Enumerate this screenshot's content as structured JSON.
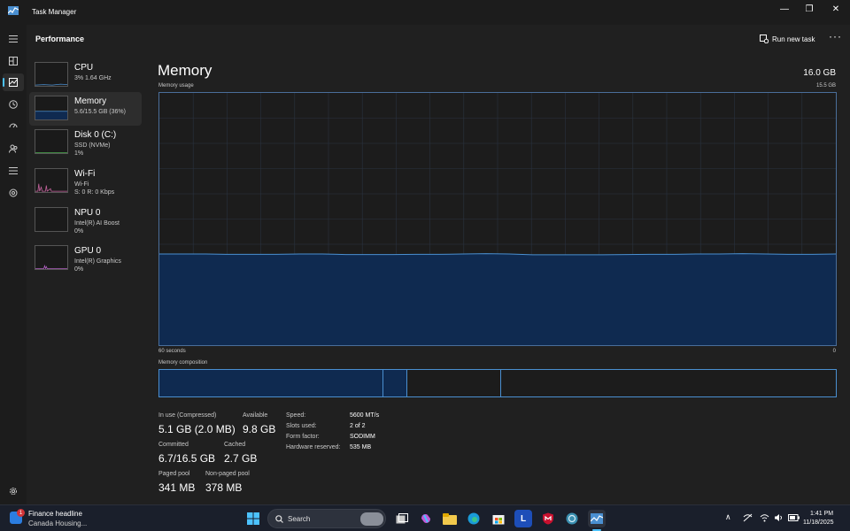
{
  "window": {
    "title": "Task Manager",
    "minimize": "—",
    "restore": "❐",
    "close": "✕"
  },
  "header": {
    "page_title": "Performance",
    "run_new_task": "Run new task",
    "more": "···"
  },
  "sidebar": {
    "items": [
      {
        "name": "CPU",
        "sub1": "3% 1.64 GHz",
        "sub2": "",
        "sub3": "",
        "color": "#4a8fd0"
      },
      {
        "name": "Memory",
        "sub1": "5.6/15.5 GB (36%)",
        "sub2": "",
        "sub3": "",
        "color": "#4a8fd0"
      },
      {
        "name": "Disk 0 (C:)",
        "sub1": "SSD (NVMe)",
        "sub2": "1%",
        "sub3": "",
        "color": "#4caf50"
      },
      {
        "name": "Wi-Fi",
        "sub1": "Wi-Fi",
        "sub2": "S: 0 R: 0 Kbps",
        "sub3": "",
        "color": "#c864a0"
      },
      {
        "name": "NPU 0",
        "sub1": "Intel(R) AI Boost",
        "sub2": "0%",
        "sub3": "",
        "color": "#4a8fd0"
      },
      {
        "name": "GPU 0",
        "sub1": "Intel(R) Graphics",
        "sub2": "0%",
        "sub3": "",
        "color": "#b060c0"
      }
    ]
  },
  "main": {
    "title": "Memory",
    "total": "16.0 GB",
    "usage_label": "Memory usage",
    "usage_max": "15.5 GB",
    "time_left": "60 seconds",
    "time_right": "0",
    "composition_label": "Memory composition"
  },
  "stats": {
    "in_use_label": "In use (Compressed)",
    "in_use_value": "5.1 GB (2.0 MB)",
    "available_label": "Available",
    "available_value": "9.8 GB",
    "committed_label": "Committed",
    "committed_value": "6.7/16.5 GB",
    "cached_label": "Cached",
    "cached_value": "2.7 GB",
    "paged_label": "Paged pool",
    "paged_value": "341 MB",
    "nonpaged_label": "Non-paged pool",
    "nonpaged_value": "378 MB"
  },
  "specs": [
    {
      "label": "Speed:",
      "value": "5600 MT/s"
    },
    {
      "label": "Slots used:",
      "value": "2 of 2"
    },
    {
      "label": "Form factor:",
      "value": "SODIMM"
    },
    {
      "label": "Hardware reserved:",
      "value": "535 MB"
    }
  ],
  "graph": {
    "max_gb": 15.5,
    "samples_gb": [
      5.6,
      5.6,
      5.6,
      5.58,
      5.58,
      5.58,
      5.6,
      5.6,
      5.57,
      5.57,
      5.57,
      5.58,
      5.58,
      5.6,
      5.62,
      5.6,
      5.55,
      5.55,
      5.56,
      5.56,
      5.57,
      5.58,
      5.58,
      5.6,
      5.6,
      5.62,
      5.6,
      5.58,
      5.58,
      5.6
    ]
  },
  "composition": {
    "in_use_fraction": 0.33,
    "modified_fraction": 0.035,
    "standby_fraction": 0.14
  },
  "taskbar": {
    "news_title": "Finance headline",
    "news_sub": "Canada Housing...",
    "news_badge": "1",
    "search_placeholder": "Search",
    "time": "1:41 PM",
    "date": "11/18/2025"
  },
  "colors": {
    "accent": "#4cc2ff",
    "graph_fill": "#0f2a50",
    "graph_line": "#4a8fd0"
  }
}
